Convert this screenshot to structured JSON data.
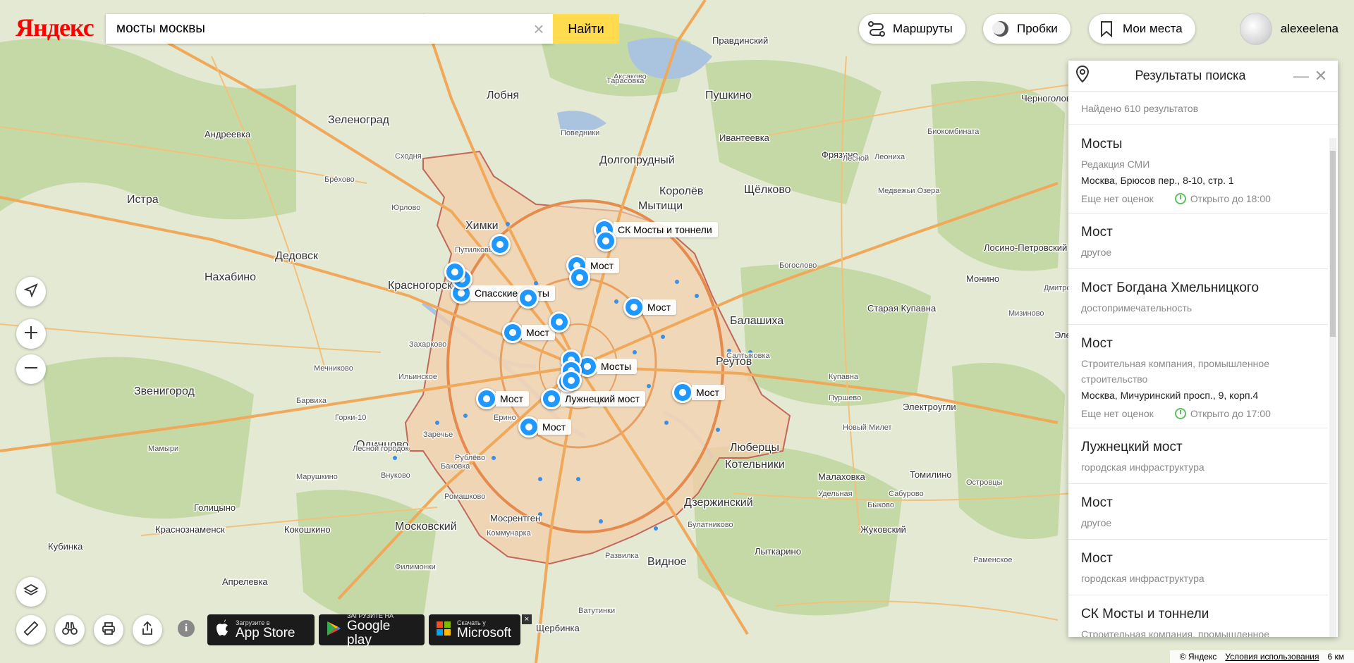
{
  "header": {
    "logo": "Яндекс",
    "search_value": "мосты москвы",
    "search_button": "Найти",
    "routes_label": "Маршруты",
    "traffic_label": "Пробки",
    "places_label": "Мои места",
    "username": "alexeelena"
  },
  "panel": {
    "title": "Результаты поиска",
    "found": "Найдено 610 результатов",
    "results": [
      {
        "name": "Мосты",
        "category": "Редакция СМИ",
        "address": "Москва, Брюсов пер., 8-10, стр. 1",
        "rating": "Еще нет оценок",
        "hours": "Открыто до 18:00"
      },
      {
        "name": "Мост",
        "category": "другое"
      },
      {
        "name": "Мост Богдана Хмельницкого",
        "category": "достопримечательность"
      },
      {
        "name": "Мост",
        "category": "Строительная компания, промышленное строительство",
        "address": "Москва, Мичуринский просп., 9, корп.4",
        "rating": "Еще нет оценок",
        "hours": "Открыто до 17:00"
      },
      {
        "name": "Лужнецкий мост",
        "category": "городская инфраструктура"
      },
      {
        "name": "Мост",
        "category": "другое"
      },
      {
        "name": "Мост",
        "category": "городская инфраструктура"
      },
      {
        "name": "СК Мосты и тоннели",
        "category": "Строительная компания, промышленное строительство"
      }
    ]
  },
  "markers": [
    {
      "label": "СК Мосты и тоннели"
    },
    {
      "label": "Мост"
    },
    {
      "label": "Мост"
    },
    {
      "label": "Спасские мосты"
    },
    {
      "label": "Мост"
    },
    {
      "label": "Мосты"
    },
    {
      "label": "Мост"
    },
    {
      "label": "Лужнецкий мост"
    },
    {
      "label": "Мост"
    },
    {
      "label": "Мост"
    }
  ],
  "map_labels": {
    "cities_big": [
      "Зеленоград",
      "Химки",
      "Мытищи",
      "Королёв",
      "Красногорск",
      "Балашиха",
      "Реутов",
      "Одинцово",
      "Люберцы",
      "Видное",
      "Пушкино",
      "Щёлково",
      "Лобня",
      "Истра",
      "Дедовск",
      "Нахабино",
      "Звенигород",
      "Московский",
      "Котельники",
      "Дзержинский",
      "Долгопрудный"
    ],
    "cities_mid": [
      "Андреевка",
      "Ивантеевка",
      "Фрязино",
      "Правдинский",
      "Старая Купавна",
      "Электроугли",
      "Малаховка",
      "Жуковский",
      "Томилино",
      "Лыткарино",
      "Кокошкино",
      "Голицыно",
      "Краснознаменск",
      "Кубинка",
      "Апрелевка",
      "Щербинка",
      "Мосрентген",
      "Лосино-Петровский",
      "Монино",
      "Черноголовка",
      "Электросталь"
    ],
    "villages": [
      "Поведники",
      "Сходня",
      "Брёхово",
      "Юрлово",
      "Путилково",
      "Захарково",
      "Ильинское",
      "Мечниково",
      "Барвиха",
      "Заречье",
      "Рублёво",
      "Баковка",
      "Ромашково",
      "Горки-10",
      "Лесной городок",
      "Внуково",
      "Коммунарка",
      "Развилка",
      "Булатниково",
      "Ватутинки",
      "Филимонки",
      "Марушкино",
      "Мамыри",
      "Ерино",
      "Салтыковка",
      "Купавна",
      "Пуршево",
      "Новый Милет",
      "Удельная",
      "Быково",
      "Островцы",
      "Раменское",
      "Сабурово",
      "Аксаково",
      "Тарасовка",
      "Лесной",
      "Богослово",
      "Медвежьи Озера",
      "Биокомбината",
      "Леониха",
      "Мизиново",
      "Дмитровское"
    ]
  },
  "badges": {
    "appstore_small": "Загрузите в",
    "appstore_large": "App Store",
    "googleplay_small": "ЗАГРУЗИТЕ НА",
    "googleplay_large": "Google play",
    "microsoft_small": "Скачать у",
    "microsoft_large": "Microsoft"
  },
  "footer": {
    "copyright": "© Яндекс",
    "terms": "Условия использования",
    "scale": "6 км"
  },
  "colors": {
    "search_button": "#ffdb4d",
    "marker": "#1e98ff",
    "logo_red": "#ff0000"
  }
}
